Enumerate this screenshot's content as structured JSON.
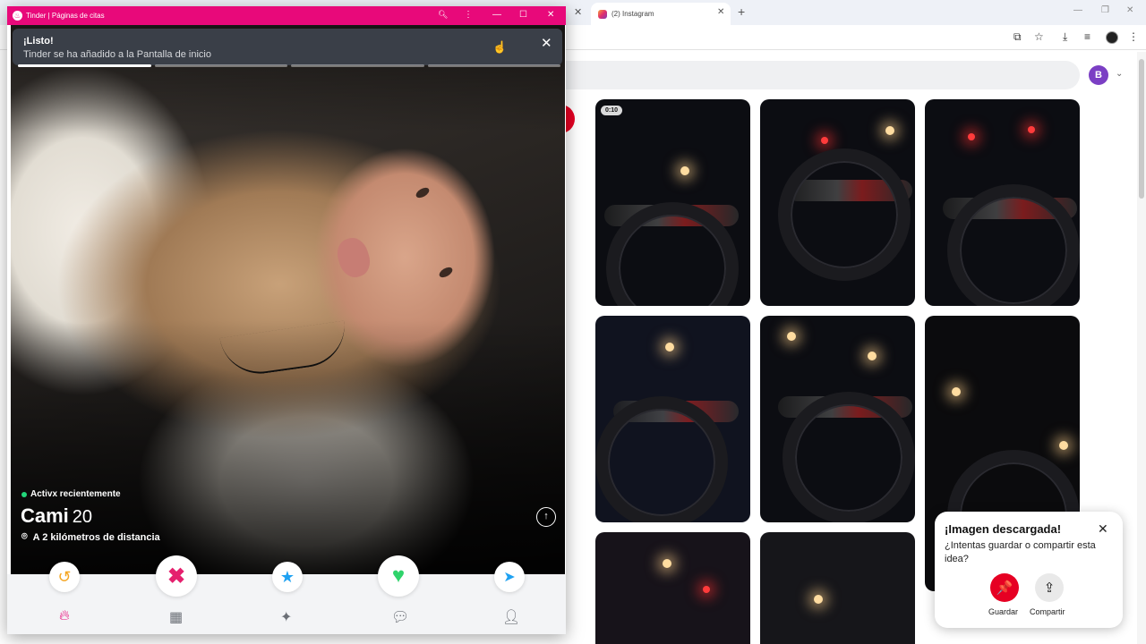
{
  "browser": {
    "tabs": [
      {
        "label": "(2) Instagram",
        "icon": "instagram-icon"
      }
    ],
    "new_tab_label": "+",
    "avatar_initial": "B"
  },
  "pinterest": {
    "video_duration": "0:10"
  },
  "toast": {
    "title": "¡Imagen descargada!",
    "text": "¿Intentas guardar o compartir esta idea?",
    "save_label": "Guardar",
    "share_label": "Compartir",
    "accent": "#e60023"
  },
  "tinder_window": {
    "title": "Tinder | Páginas de citas",
    "brand_color": "#e8097a",
    "banner": {
      "title": "¡Listo!",
      "subtitle": "Tinder se ha añadido a la Pantalla de inicio"
    },
    "photo_progress": {
      "total": 4,
      "current": 1
    },
    "profile": {
      "status": "Activx recientemente",
      "name": "Cami",
      "age": "20",
      "distance": "A 2 kilómetros de distancia"
    },
    "action_buttons": [
      {
        "name": "rewind-icon",
        "color": "#f5a623"
      },
      {
        "name": "nope-icon",
        "color": "#e5206e"
      },
      {
        "name": "super-like-icon",
        "color": "#1ea1f2"
      },
      {
        "name": "like-icon",
        "color": "#2fd36b"
      },
      {
        "name": "boost-icon",
        "color": "#1ea1f2"
      }
    ],
    "bottom_nav": [
      "flame-icon",
      "explore-icon",
      "sparkle-icon",
      "chat-icon",
      "profile-icon"
    ]
  }
}
